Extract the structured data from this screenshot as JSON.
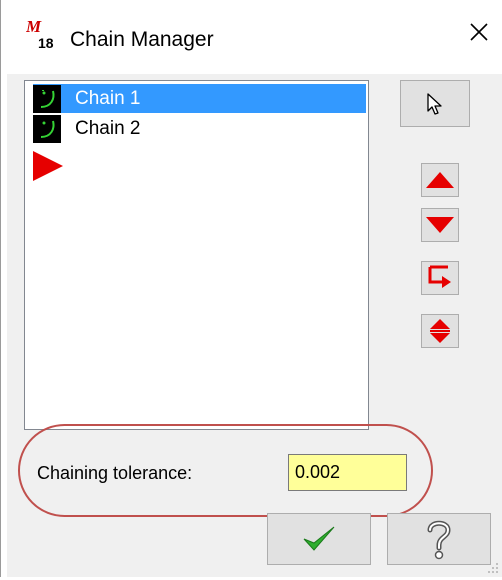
{
  "window": {
    "title": "Chain Manager",
    "app_icon": "mastercam-icon"
  },
  "chains": [
    {
      "label": "Chain 1",
      "selected": true
    },
    {
      "label": "Chain 2",
      "selected": false
    }
  ],
  "buttons": {
    "select": "select-pointer-icon",
    "move_up": "arrow-up-icon",
    "move_down": "arrow-down-icon",
    "reverse": "reverse-icon",
    "toggle": "flip-icon",
    "ok": "checkmark-icon",
    "help": "help-icon"
  },
  "tolerance": {
    "label": "Chaining tolerance:",
    "value": "0.002"
  },
  "colors": {
    "selection": "#3399ff",
    "accent_red": "#e60000",
    "input_bg": "#ffff99",
    "highlight": "#c0504d",
    "ok_green": "#2fae2f"
  }
}
